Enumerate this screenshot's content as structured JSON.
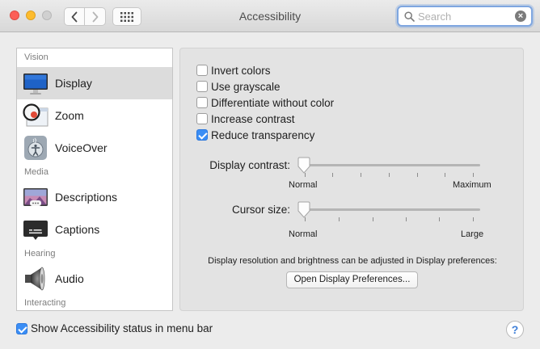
{
  "window": {
    "title": "Accessibility"
  },
  "search": {
    "placeholder": "Search"
  },
  "sidebar": {
    "sections": [
      {
        "header": "Vision",
        "items": [
          {
            "label": "Display",
            "icon": "display-icon",
            "selected": true
          },
          {
            "label": "Zoom",
            "icon": "zoom-icon"
          },
          {
            "label": "VoiceOver",
            "icon": "voiceover-icon"
          }
        ]
      },
      {
        "header": "Media",
        "items": [
          {
            "label": "Descriptions",
            "icon": "descriptions-icon"
          },
          {
            "label": "Captions",
            "icon": "captions-icon"
          }
        ]
      },
      {
        "header": "Hearing",
        "items": [
          {
            "label": "Audio",
            "icon": "audio-icon"
          }
        ]
      },
      {
        "header": "Interacting",
        "items": []
      }
    ]
  },
  "display": {
    "options": [
      {
        "label": "Invert colors",
        "checked": false
      },
      {
        "label": "Use grayscale",
        "checked": false
      },
      {
        "label": "Differentiate without color",
        "checked": false
      },
      {
        "label": "Increase contrast",
        "checked": false
      },
      {
        "label": "Reduce transparency",
        "checked": true
      }
    ],
    "contrast": {
      "label": "Display contrast:",
      "min_label": "Normal",
      "max_label": "Maximum",
      "value": 0
    },
    "cursor": {
      "label": "Cursor size:",
      "min_label": "Normal",
      "max_label": "Large",
      "value": 0
    },
    "info_text": "Display resolution and brightness can be adjusted in Display preferences:",
    "open_prefs_label": "Open Display Preferences..."
  },
  "footer": {
    "status_label": "Show Accessibility status in menu bar",
    "status_checked": true,
    "help_label": "?"
  },
  "colors": {
    "accent": "#3b8ef5",
    "focus_ring": "#7ea6e0"
  }
}
